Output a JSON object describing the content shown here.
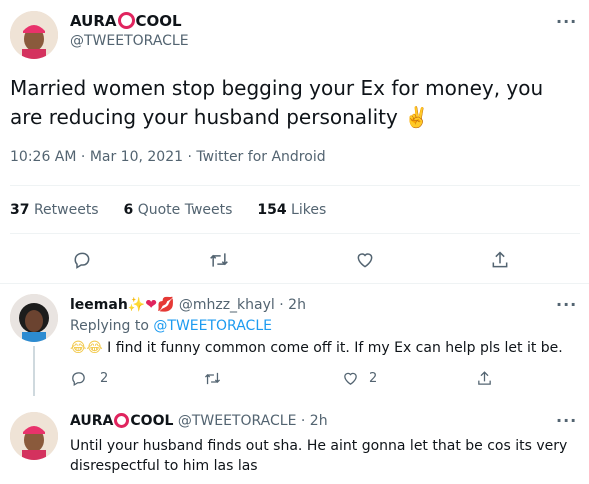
{
  "main_tweet": {
    "name_pre": "AURA",
    "name_post": "COOL",
    "handle": "@TWEETORACLE",
    "more": "···",
    "text_line1": "Married women stop begging your Ex for money, you",
    "text_line2": "are reducing your husband personality",
    "text_emoji": "✌️",
    "time": "10:26 AM",
    "date": "Mar 10, 2021",
    "client": "Twitter for Android",
    "sep": "·",
    "stats": {
      "retweets_count": "37",
      "retweets_label": "Retweets",
      "quotes_count": "6",
      "quotes_label": "Quote Tweets",
      "likes_count": "154",
      "likes_label": "Likes"
    }
  },
  "reply1": {
    "name": "leemah",
    "emojis": "✨❤💋",
    "handle": "@mhzz_khayl",
    "age": "2h",
    "sep": "·",
    "more": "···",
    "replying_prefix": "Replying to",
    "replying_to": "@TWEETORACLE",
    "text_emoji": "😂😂",
    "text": "I find it funny common come off it. If my Ex can help pls let it be.",
    "reply_count": "2",
    "like_count": "2"
  },
  "reply2": {
    "name_pre": "AURA",
    "name_post": "COOL",
    "handle": "@TWEETORACLE",
    "age": "2h",
    "sep": "·",
    "more": "···",
    "text_line1": "Until your husband finds out sha. He aint gonna let that be cos its very",
    "text_line2": "disrespectful to him las las"
  },
  "colors": {
    "accent": "#1d9bf0",
    "ring": "#e0245e",
    "muted": "#536471"
  }
}
